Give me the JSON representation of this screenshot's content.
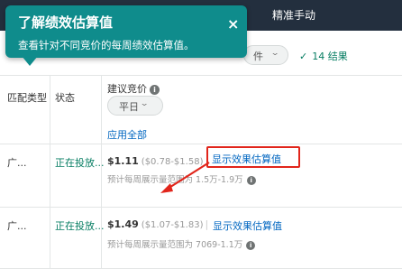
{
  "topbar": {
    "text": "精准手动"
  },
  "filters": {
    "select_label": "件",
    "results_label": "14 结果"
  },
  "tooltip": {
    "title": "了解绩效估算值",
    "body": "查看针对不同竞价的每周绩效估算值。",
    "close_glyph": "×"
  },
  "table": {
    "headers": {
      "match_type": "匹配类型",
      "status": "状态",
      "suggested_bid": "建议竞价"
    },
    "weekday_select": "平日",
    "apply_all": "应用全部",
    "rows": [
      {
        "match_type": "广...",
        "status": "正在投放...",
        "bid": "$1.11",
        "range": "($0.78-$1.58)",
        "show_estimate": "显示效果估算值",
        "estimate_text": "预计每周展示量范围为 1.5万-1.9万"
      },
      {
        "match_type": "广...",
        "status": "正在投放...",
        "bid": "$1.49",
        "range": "($1.07-$1.83)",
        "separator": "|",
        "show_estimate": "显示效果估算值",
        "estimate_text": "预计每周展示量范围为 7069-1.1万"
      }
    ]
  },
  "icons": {
    "info": "info-icon",
    "close": "close-icon",
    "check": "check-icon",
    "chevron": "chevron-down-icon",
    "arrow": "arrow-annotation"
  },
  "colors": {
    "tooltip_bg": "#0f8c8c",
    "link": "#0066c0",
    "status_green": "#067d62",
    "annotation_red": "#e1251b",
    "topbar": "#232f3e"
  }
}
